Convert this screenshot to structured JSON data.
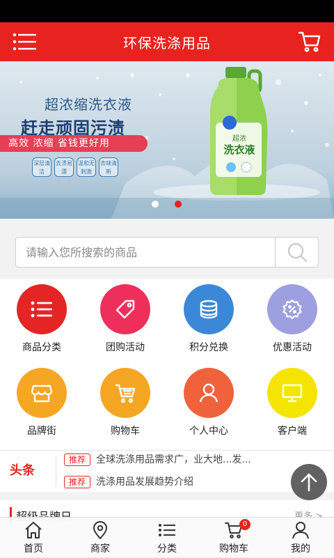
{
  "header": {
    "title": "环保洗涤用品",
    "menu_icon": "menu-icon",
    "cart_icon": "cart-icon"
  },
  "banner": {
    "headline1": "超浓缩洗衣液",
    "headline2": "赶走顽固污渍",
    "ribbon": "高效  浓缩  省钱更好用",
    "tags": [
      "深层清洁",
      "去渍易漂",
      "温和无刺激",
      "去味清新"
    ],
    "bottle_label": "洗衣液",
    "bottle_sublabel": "超浓",
    "slide_count": 2,
    "active_slide": 2
  },
  "search": {
    "placeholder": "请输入您所搜索的商品",
    "icon": "search-icon"
  },
  "menu_grid": [
    {
      "label": "商品分类",
      "icon": "list-icon",
      "color": "#e52525"
    },
    {
      "label": "团购活动",
      "icon": "tag-icon",
      "color": "#ee2f5c"
    },
    {
      "label": "积分兑换",
      "icon": "coins-icon",
      "color": "#3b88d8"
    },
    {
      "label": "优惠活动",
      "icon": "discount-icon",
      "color": "#9e9fe0"
    },
    {
      "label": "品牌街",
      "icon": "store-icon",
      "color": "#f5a623"
    },
    {
      "label": "购物车",
      "icon": "cart-icon",
      "color": "#f5a623"
    },
    {
      "label": "个人中心",
      "icon": "user-icon",
      "color": "#f0623c"
    },
    {
      "label": "客户端",
      "icon": "monitor-icon",
      "color": "#f4e400"
    }
  ],
  "news": {
    "brand": "头条",
    "items": [
      {
        "tag": "推荐",
        "text": "全球洗涤用品需求广，业大地...发..."
      },
      {
        "tag": "推荐",
        "text": "洗涤用品发展趋势介绍"
      }
    ]
  },
  "brands": {
    "title": "超级品牌日",
    "more": "更多 >"
  },
  "tabbar": [
    {
      "label": "首页",
      "icon": "home-icon"
    },
    {
      "label": "商家",
      "icon": "location-pin-icon"
    },
    {
      "label": "分类",
      "icon": "list-icon"
    },
    {
      "label": "购物车",
      "icon": "cart-icon",
      "badge": "0"
    },
    {
      "label": "我的",
      "icon": "user-icon"
    }
  ],
  "colors": {
    "brand_red": "#e8231f"
  }
}
